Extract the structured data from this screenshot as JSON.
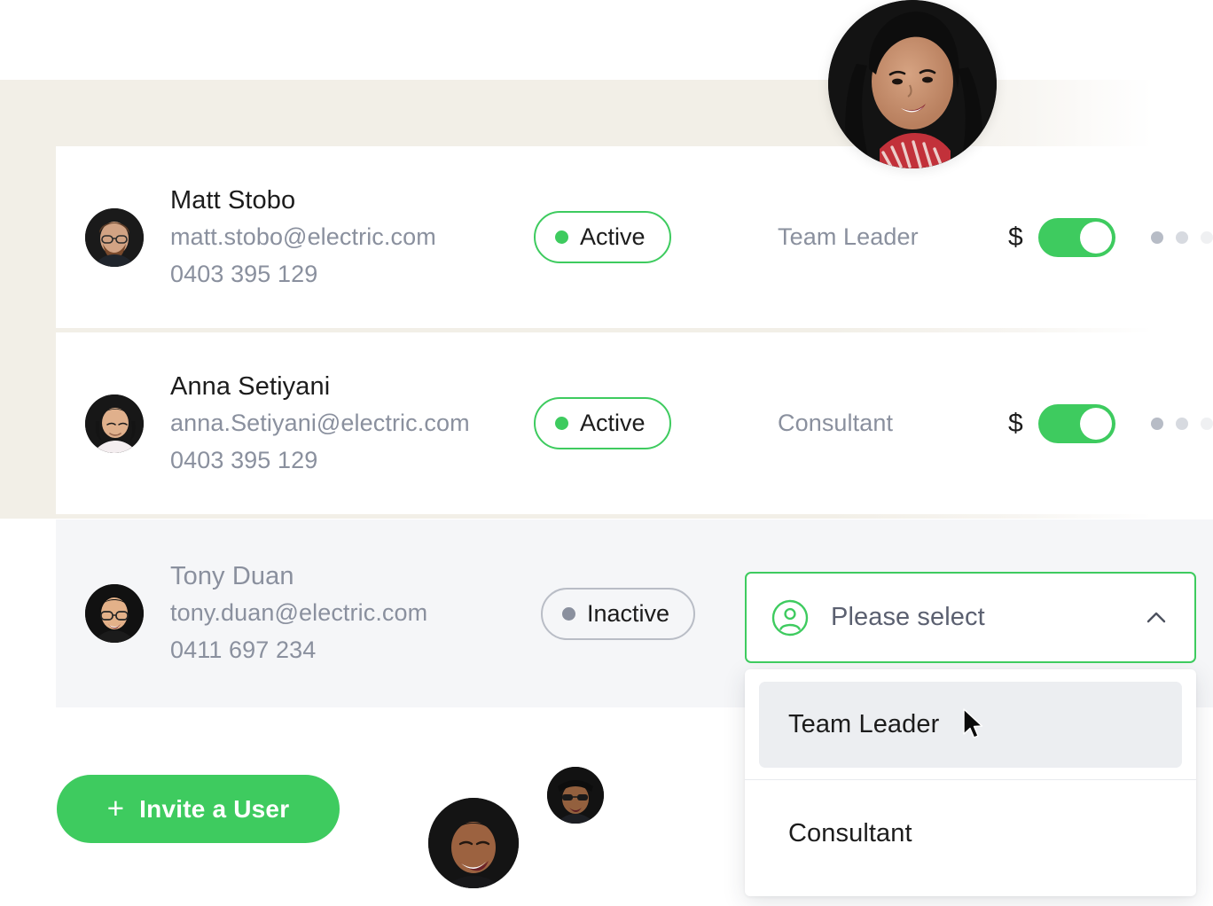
{
  "theme": {
    "brand_green": "#3ECB5F",
    "beige_bg": "#F2EFE7",
    "inactive_row_bg": "#F5F6F8",
    "muted_text": "#8A909E",
    "primary_text": "#1C1C1C",
    "highlight_bg": "#ECEEF1"
  },
  "users": [
    {
      "name": "Matt Stobo",
      "email": "matt.stobo@electric.com",
      "phone": "0403 395 129",
      "status": "Active",
      "role": "Team Leader",
      "billing_symbol": "$",
      "billing_enabled": true
    },
    {
      "name": "Anna Setiyani",
      "email": "anna.Setiyani@electric.com",
      "phone": "0403 395 129",
      "status": "Active",
      "role": "Consultant",
      "billing_symbol": "$",
      "billing_enabled": true
    },
    {
      "name": "Tony Duan",
      "email": "tony.duan@electric.com",
      "phone": "0411 697 234",
      "status": "Inactive",
      "role": "",
      "billing_symbol": "",
      "billing_enabled": false
    }
  ],
  "invite": {
    "label": "Invite a User",
    "plus": "+"
  },
  "role_select": {
    "placeholder": "Please select",
    "expanded": true,
    "options": [
      {
        "label": "Team Leader",
        "highlighted": true
      },
      {
        "label": "Consultant",
        "highlighted": false
      }
    ]
  }
}
